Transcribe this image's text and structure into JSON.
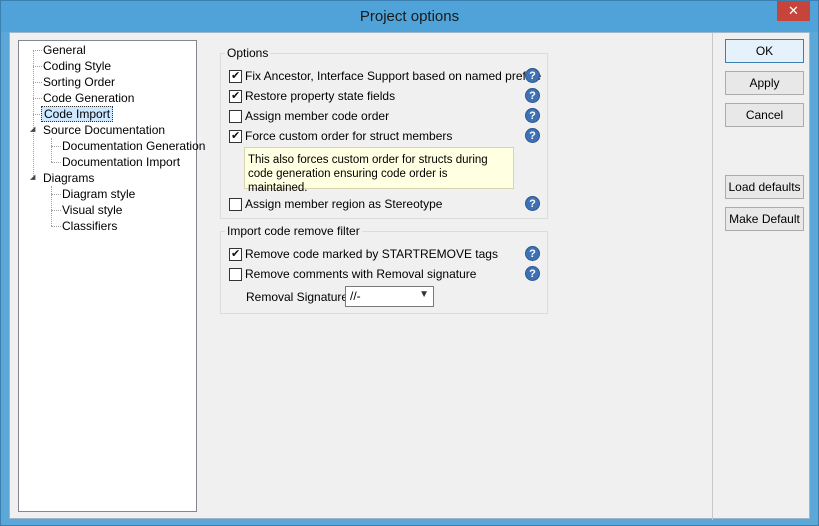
{
  "window": {
    "title": "Project options",
    "close_glyph": "✕"
  },
  "tree": {
    "items": [
      "General",
      "Coding Style",
      "Sorting Order",
      "Code Generation",
      "Code Import",
      "Source Documentation",
      "Documentation Generation",
      "Documentation Import",
      "Diagrams",
      "Diagram style",
      "Visual style",
      "Classifiers"
    ],
    "selected": "Code Import"
  },
  "options": {
    "legend": "Options",
    "fix_ancestor": {
      "label": "Fix Ancestor, Interface Support based on named prefixe",
      "checked": true
    },
    "restore_property": {
      "label": "Restore property state fields",
      "checked": true
    },
    "assign_member": {
      "label": "Assign member code order",
      "checked": false
    },
    "force_custom": {
      "label": "Force custom order for struct members",
      "checked": true
    },
    "note": "This also forces custom order for structs during code generation ensuring code order is maintained.",
    "assign_region": {
      "label": "Assign member region as Stereotype",
      "checked": false
    }
  },
  "import_filter": {
    "legend": "Import code remove filter",
    "remove_code": {
      "label": "Remove code marked by STARTREMOVE tags",
      "checked": true
    },
    "remove_comments": {
      "label": "Remove comments with Removal signature",
      "checked": false
    },
    "signature_label": "Removal Signature",
    "signature_value": "//-"
  },
  "help_glyph": "?",
  "select_arrow": "▼",
  "buttons": {
    "ok": "OK",
    "apply": "Apply",
    "cancel": "Cancel",
    "load_defaults": "Load defaults",
    "make_default": "Make Default"
  }
}
